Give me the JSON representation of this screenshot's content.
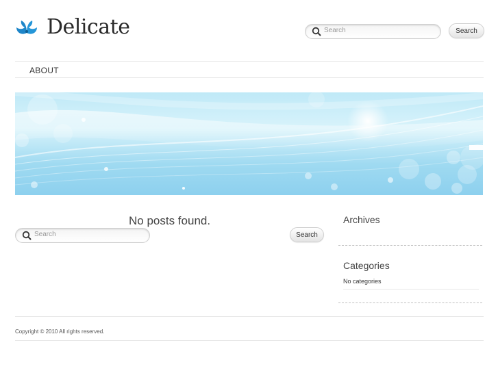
{
  "header": {
    "site_title": "Delicate",
    "search": {
      "placeholder": "Search",
      "button_label": "Search"
    }
  },
  "nav": {
    "items": [
      {
        "label": "ABOUT"
      }
    ]
  },
  "main": {
    "message": "No posts found.",
    "search": {
      "placeholder": "Search",
      "button_label": "Search"
    }
  },
  "sidebar": {
    "archives": {
      "title": "Archives"
    },
    "categories": {
      "title": "Categories",
      "empty_text": "No categories"
    }
  },
  "footer": {
    "copyright": "Copyright © 2010 All rights reserved."
  },
  "colors": {
    "logo_blue": "#1e86c9",
    "banner_light": "#d8f3fb",
    "banner_dark": "#8dd0ee"
  }
}
